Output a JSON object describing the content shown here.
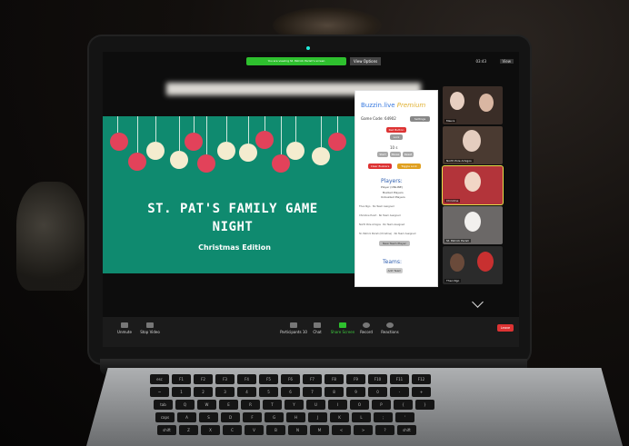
{
  "zoom": {
    "share_banner": "You are viewing St. Patrick Parish's screen",
    "view_options": "View Options",
    "clock": "03:43",
    "view_label": "View"
  },
  "slide": {
    "title_line1": "ST. PAT'S FAMILY GAME",
    "title_line2": "NIGHT",
    "subtitle": "Christmas Edition"
  },
  "buzzin": {
    "brand": "Buzzin.live",
    "tier": "Premium",
    "game_code_label": "Game Code: 64902",
    "settings_label": "Settings",
    "red_button": "Red Button",
    "lock": "Lock",
    "timer": "10 s",
    "timer_buttons": [
      "Start",
      "Pause",
      "Reset"
    ],
    "clear_buzzers": "Clear Buzzers",
    "toggle_lock": "Toggle Lock",
    "players_heading": "Players:",
    "players_sub": "Player (ONLINE)",
    "buzzed_players": "Buzzed Players",
    "unbuzzed_players": "Unbuzzed Players",
    "player_rows": [
      {
        "name": "Theo Ngo",
        "team": "No Team Assigned"
      },
      {
        "name": "Christine Evert",
        "team": "No Team Assigned"
      },
      {
        "name": "North Pole Amigos",
        "team": "No Team Assigned"
      },
      {
        "name": "St. Patrick Parish (Christine)",
        "team": "No Team Assigned"
      }
    ],
    "new_team_btn": "New Team Player",
    "teams_heading": "Teams:",
    "add_team": "Add Team"
  },
  "gallery": {
    "tiles": [
      {
        "name": "Maura"
      },
      {
        "name": "North Pole Amigos"
      },
      {
        "name": "Christine"
      },
      {
        "name": "St. Patrick Parish"
      },
      {
        "name": "Theo Ngo"
      }
    ]
  },
  "toolbar": {
    "unmute": "Unmute",
    "stop_video": "Stop Video",
    "participants": "Participants",
    "participants_count": "10",
    "chat": "Chat",
    "share_screen": "Share Screen",
    "record": "Record",
    "reactions": "Reactions",
    "leave": "Leave"
  },
  "keyboard": {
    "row1": [
      "esc",
      "F1",
      "F2",
      "F3",
      "F4",
      "F5",
      "F6",
      "F7",
      "F8",
      "F9",
      "F10",
      "F11",
      "F12"
    ],
    "row2": [
      "~",
      "1",
      "2",
      "3",
      "4",
      "5",
      "6",
      "7",
      "8",
      "9",
      "0",
      "-",
      "+"
    ],
    "row3": [
      "tab",
      "Q",
      "W",
      "E",
      "R",
      "T",
      "Y",
      "U",
      "I",
      "O",
      "P",
      "{",
      "}"
    ],
    "row4": [
      "caps",
      "A",
      "S",
      "D",
      "F",
      "G",
      "H",
      "J",
      "K",
      "L",
      ";",
      "'"
    ],
    "row5": [
      "shift",
      "Z",
      "X",
      "C",
      "V",
      "B",
      "N",
      "M",
      "<",
      ">",
      "?",
      "shift"
    ]
  },
  "colors": {
    "slide_bg": "#0f8a6f",
    "ornament_red": "#e2425a",
    "ornament_cream": "#f4eccf",
    "share_green": "#2ec02e",
    "leave_red": "#dd3333"
  }
}
